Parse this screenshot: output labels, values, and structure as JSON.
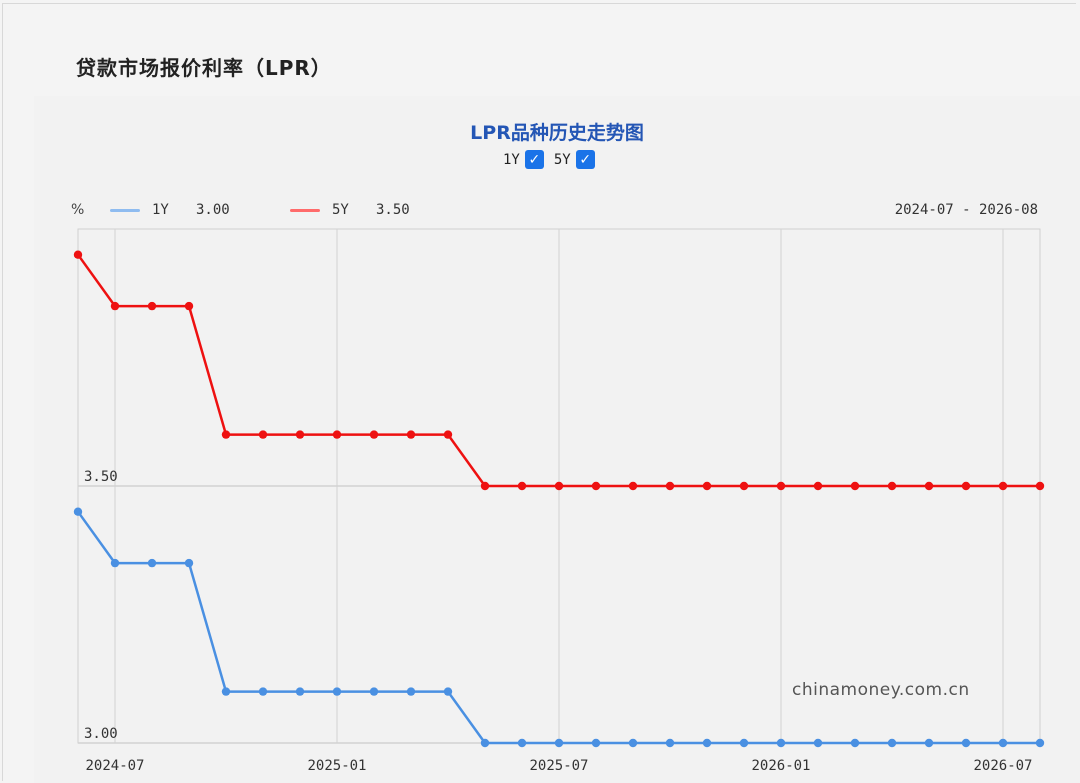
{
  "page": {
    "title": "贷款市场报价利率（LPR）"
  },
  "chart_title": "LPR品种历史走势图",
  "toggles": [
    {
      "label": "1Y",
      "checked": true
    },
    {
      "label": "5Y",
      "checked": true
    }
  ],
  "legend": {
    "unit": "%",
    "items": [
      {
        "name": "1Y",
        "value": "3.00",
        "color": "#4a90e2"
      },
      {
        "name": "5Y",
        "value": "3.50",
        "color": "#ff3333"
      }
    ],
    "range": "2024-07 - 2026-08"
  },
  "watermark": "chinamoney.com.cn",
  "chart_data": {
    "type": "line",
    "x": [
      "2024-06",
      "2024-07",
      "2024-08",
      "2024-09",
      "2024-10",
      "2024-11",
      "2024-12",
      "2025-01",
      "2025-02",
      "2025-03",
      "2025-04",
      "2025-05",
      "2025-06",
      "2025-07",
      "2025-08",
      "2025-09",
      "2025-10",
      "2025-11",
      "2025-12",
      "2026-01",
      "2026-02",
      "2026-03",
      "2026-04",
      "2026-05",
      "2026-06",
      "2026-07",
      "2026-08"
    ],
    "series": [
      {
        "name": "1Y",
        "color": "#4a90e2",
        "values": [
          3.45,
          3.35,
          3.35,
          3.35,
          3.1,
          3.1,
          3.1,
          3.1,
          3.1,
          3.1,
          3.1,
          3.0,
          3.0,
          3.0,
          3.0,
          3.0,
          3.0,
          3.0,
          3.0,
          3.0,
          3.0,
          3.0,
          3.0,
          3.0,
          3.0,
          3.0,
          3.0
        ]
      },
      {
        "name": "5Y",
        "color": "#ee1111",
        "values": [
          3.95,
          3.85,
          3.85,
          3.85,
          3.6,
          3.6,
          3.6,
          3.6,
          3.6,
          3.6,
          3.6,
          3.5,
          3.5,
          3.5,
          3.5,
          3.5,
          3.5,
          3.5,
          3.5,
          3.5,
          3.5,
          3.5,
          3.5,
          3.5,
          3.5,
          3.5,
          3.5
        ]
      }
    ],
    "y_ticks": [
      "3.00",
      "3.50"
    ],
    "x_ticks": [
      "2024-07",
      "2025-01",
      "2025-07",
      "2026-01",
      "2026-07"
    ],
    "ylim": [
      3.0,
      4.0
    ],
    "grid": true
  }
}
